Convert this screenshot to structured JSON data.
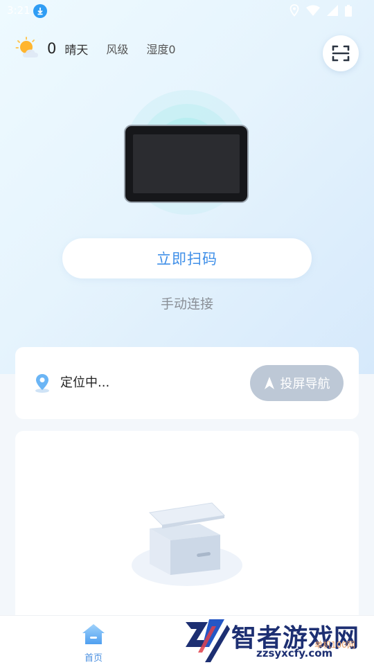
{
  "status_bar": {
    "time": "3:21"
  },
  "weather": {
    "icon": "partly-sunny-icon",
    "temperature": "0",
    "condition": "晴天",
    "wind": "风级",
    "humidity": "湿度0"
  },
  "header": {
    "scan_icon": "scan-frame-icon"
  },
  "hero": {
    "scan_button_label": "立即扫码",
    "manual_connect_label": "手动连接"
  },
  "location": {
    "status_text": "定位中...",
    "cast_nav_label": "投屏导航"
  },
  "bottom_nav": {
    "items": [
      {
        "label": "首页",
        "icon": "home-icon"
      }
    ]
  },
  "watermark": {
    "title": "智者游戏网",
    "subtitle": "zzsyxcfy.com",
    "subtitle2": "单机100网"
  },
  "colors": {
    "accent": "#3f8fe8",
    "nav_button_bg": "#bdc8d6",
    "hero_gradient_start": "#eefaff",
    "hero_gradient_end": "#d6e9fb"
  }
}
